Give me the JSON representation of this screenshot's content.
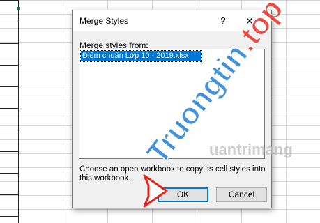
{
  "dialog": {
    "title": "Merge Styles",
    "help_glyph": "?",
    "close_glyph": "✕",
    "list_label_prefix": "M",
    "list_label_rest": "erge styles from:",
    "items": [
      "Điểm chuẩn Lớp 10 - 2019.xlsx"
    ],
    "hint": "Choose an open workbook to copy its cell styles into this workbook.",
    "ok_label": "OK",
    "cancel_label": "Cancel"
  },
  "watermark": {
    "brand_main": "Truongtin",
    "brand_tld": ".top",
    "secondary": "uantrimang"
  },
  "colors": {
    "selection": "#0078d7",
    "arrow_red": "#e32119",
    "watermark_blue": "#1f7fd6",
    "watermark_red": "#e8392f"
  }
}
